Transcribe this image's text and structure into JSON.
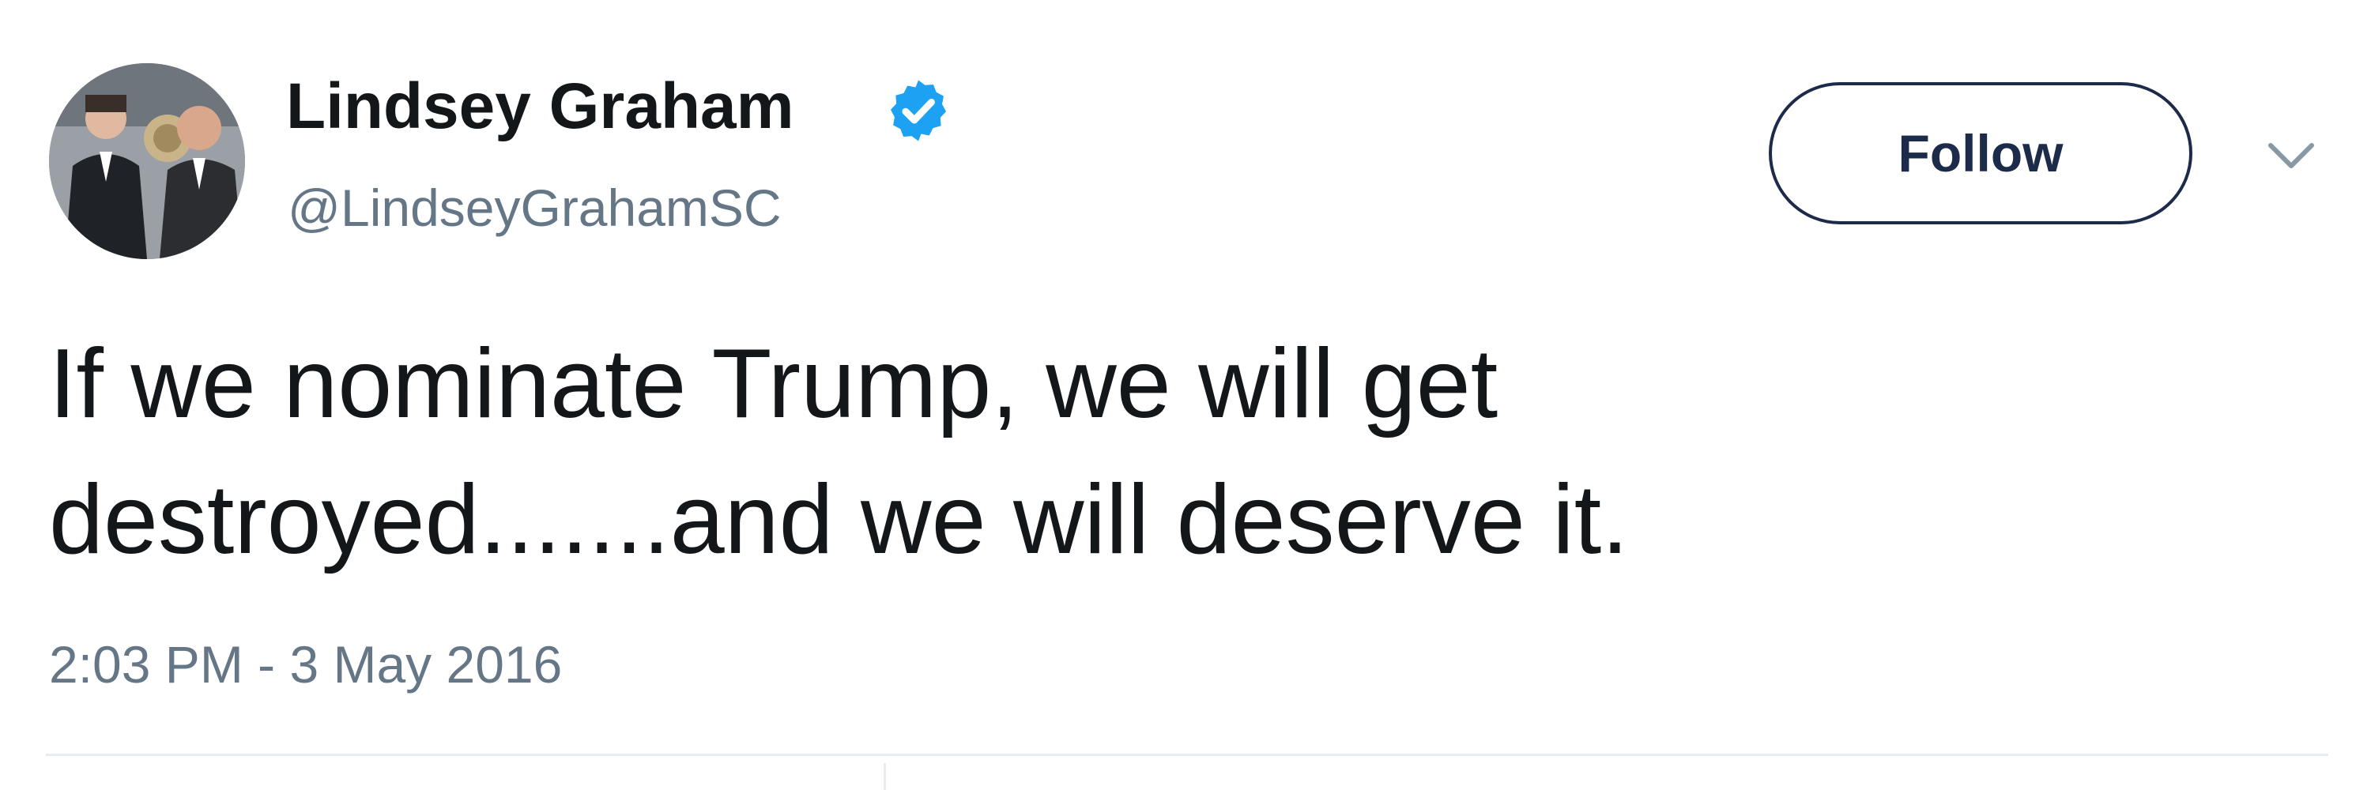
{
  "author": {
    "name": "Lindsey Graham",
    "handle": "@LindseyGrahamSC",
    "verified": true
  },
  "actions": {
    "follow_label": "Follow",
    "menu_icon": "chevron-down-icon"
  },
  "tweet": {
    "text_lines": [
      "If we nominate Trump, we will get",
      "destroyed.......and we will deserve it."
    ],
    "timestamp": "2:03 PM - 3 May 2016"
  },
  "colors": {
    "verified_blue": "#1da1f2",
    "text_primary": "#14171a",
    "text_secondary": "#657786",
    "follow_border": "#1c2b4a",
    "divider": "#e6ecf0"
  }
}
